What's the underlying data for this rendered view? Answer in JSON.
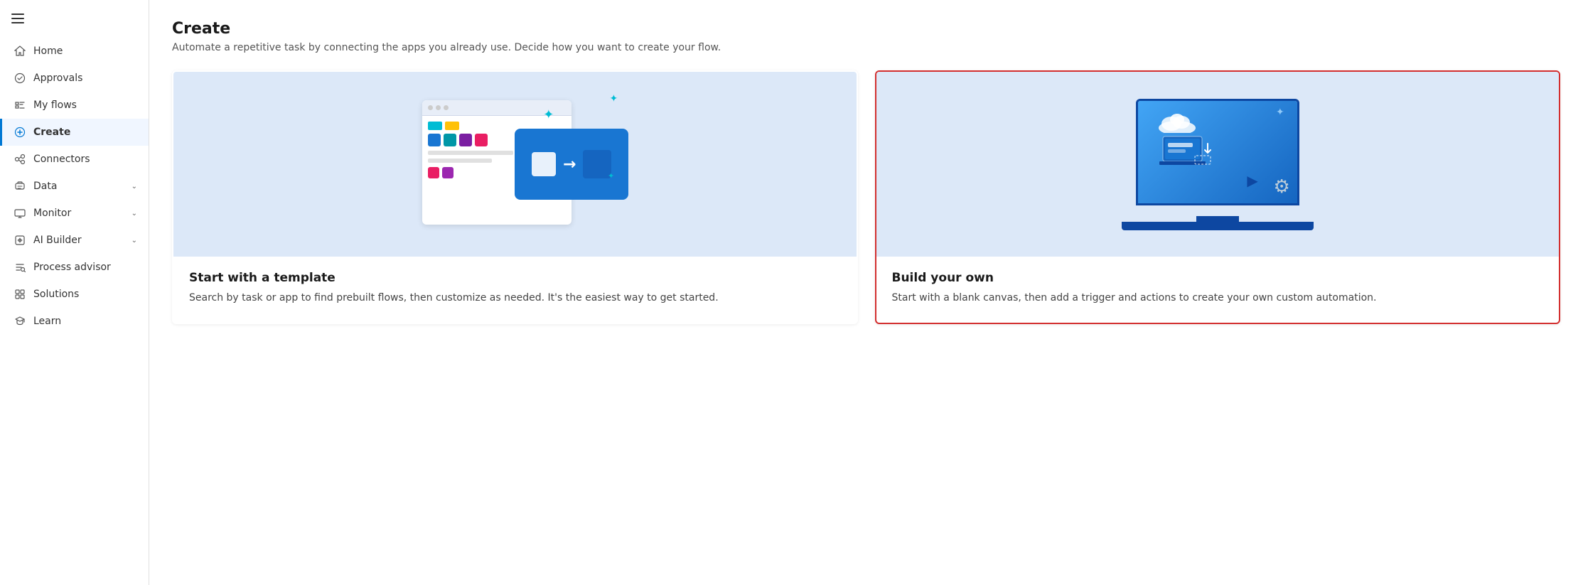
{
  "sidebar": {
    "hamburger_icon": "☰",
    "items": [
      {
        "id": "home",
        "label": "Home",
        "icon": "home",
        "active": false,
        "has_chevron": false
      },
      {
        "id": "approvals",
        "label": "Approvals",
        "icon": "approvals",
        "active": false,
        "has_chevron": false
      },
      {
        "id": "my-flows",
        "label": "My flows",
        "icon": "flows",
        "active": false,
        "has_chevron": false
      },
      {
        "id": "create",
        "label": "Create",
        "icon": "plus",
        "active": true,
        "has_chevron": false
      },
      {
        "id": "connectors",
        "label": "Connectors",
        "icon": "connectors",
        "active": false,
        "has_chevron": false
      },
      {
        "id": "data",
        "label": "Data",
        "icon": "data",
        "active": false,
        "has_chevron": true
      },
      {
        "id": "monitor",
        "label": "Monitor",
        "icon": "monitor",
        "active": false,
        "has_chevron": true
      },
      {
        "id": "ai-builder",
        "label": "AI Builder",
        "icon": "ai",
        "active": false,
        "has_chevron": true
      },
      {
        "id": "process-advisor",
        "label": "Process advisor",
        "icon": "process",
        "active": false,
        "has_chevron": false
      },
      {
        "id": "solutions",
        "label": "Solutions",
        "icon": "solutions",
        "active": false,
        "has_chevron": false
      },
      {
        "id": "learn",
        "label": "Learn",
        "icon": "learn",
        "active": false,
        "has_chevron": false
      }
    ]
  },
  "main": {
    "title": "Create",
    "subtitle": "Automate a repetitive task by connecting the apps you already use. Decide how you want to create your flow.",
    "cards": [
      {
        "id": "template",
        "title": "Start with a template",
        "description": "Search by task or app to find prebuilt flows, then customize as needed. It's the easiest way to get started.",
        "selected": false
      },
      {
        "id": "build-own",
        "title": "Build your own",
        "description": "Start with a blank canvas, then add a trigger and actions to create your own custom automation.",
        "selected": true
      }
    ]
  }
}
